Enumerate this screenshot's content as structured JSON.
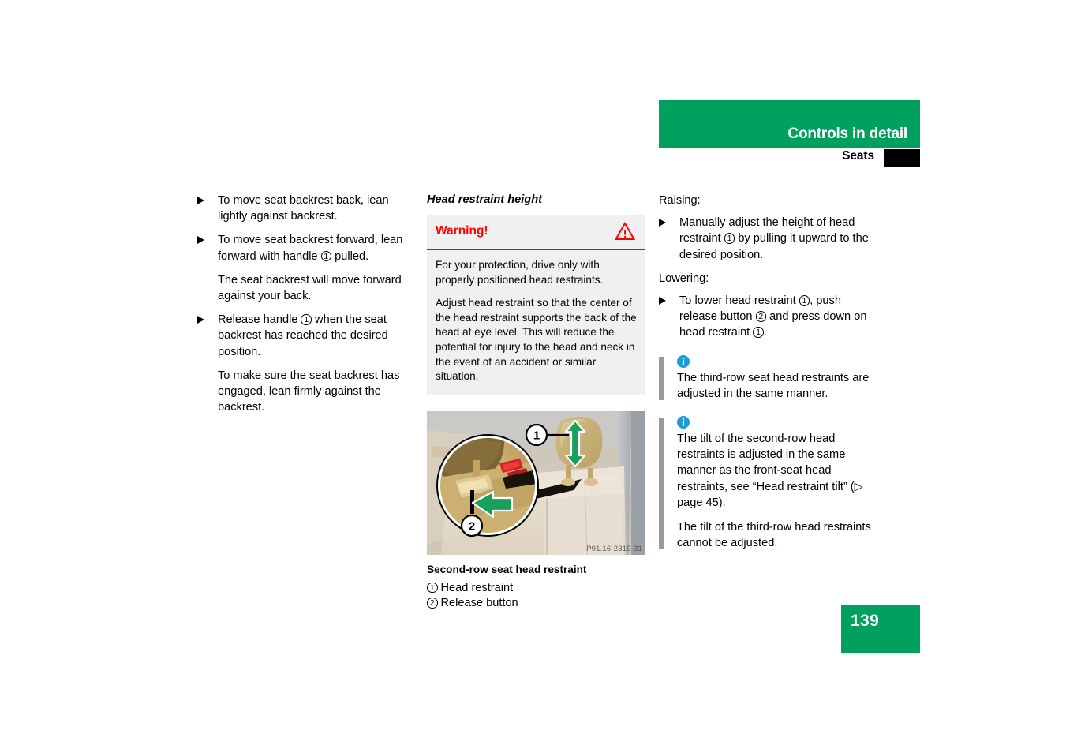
{
  "header": {
    "title": "Controls in detail",
    "section": "Seats",
    "tab_icon": "black-tab-marker"
  },
  "page_number": "139",
  "left_column": {
    "items": [
      {
        "type": "bullet",
        "icon": "triangle-bullet-icon",
        "parts": [
          {
            "t": "text",
            "v": "To move seat backrest back, lean lightly against backrest."
          }
        ]
      },
      {
        "type": "bullet",
        "icon": "triangle-bullet-icon",
        "parts": [
          {
            "t": "text",
            "v": "To move seat backrest forward, lean forward with handle "
          },
          {
            "t": "circled",
            "v": "1"
          },
          {
            "t": "text",
            "v": " pulled."
          }
        ]
      },
      {
        "type": "sub",
        "parts": [
          {
            "t": "text",
            "v": "The seat backrest will move forward against your back."
          }
        ]
      },
      {
        "type": "bullet",
        "icon": "triangle-bullet-icon",
        "parts": [
          {
            "t": "text",
            "v": "Release handle "
          },
          {
            "t": "circled",
            "v": "1"
          },
          {
            "t": "text",
            "v": " when the seat backrest has reached the desired position."
          }
        ]
      },
      {
        "type": "sub",
        "parts": [
          {
            "t": "text",
            "v": "To make sure the seat backrest has engaged, lean firmly against the backrest."
          }
        ]
      }
    ]
  },
  "middle_column": {
    "subheading": "Head restraint height",
    "warning": {
      "title": "Warning!",
      "icon": "warning-triangle-icon",
      "paragraphs": [
        "For your protection, drive only with properly positioned head restraints.",
        "Adjust head restraint so that the center of the head restraint supports the back of the head at eye level. This will reduce the potential for injury to the head and neck in the event of an accident or similar situation."
      ]
    },
    "figure": {
      "photo_id": "P91.16-2319-31",
      "alt_name": "second-row-seat-head-restraint-illustration",
      "caption": "Second-row seat head restraint",
      "legend": [
        {
          "num": "1",
          "label": "Head restraint"
        },
        {
          "num": "2",
          "label": "Release button"
        }
      ],
      "callouts": [
        {
          "num": "1",
          "meaning": "head restraint"
        },
        {
          "num": "2",
          "meaning": "release button"
        }
      ]
    }
  },
  "right_column": {
    "raising_label": "Raising:",
    "raising_bullet": [
      {
        "t": "text",
        "v": "Manually adjust the height of head restraint "
      },
      {
        "t": "circled",
        "v": "1"
      },
      {
        "t": "text",
        "v": " by pulling it upward to the desired position."
      }
    ],
    "lowering_label": "Lowering:",
    "lowering_bullet": [
      {
        "t": "text",
        "v": "To lower head restraint "
      },
      {
        "t": "circled",
        "v": "1"
      },
      {
        "t": "text",
        "v": ", push release button "
      },
      {
        "t": "circled",
        "v": "2"
      },
      {
        "t": "text",
        "v": " and press down on head restraint "
      },
      {
        "t": "circled",
        "v": "1"
      },
      {
        "t": "text",
        "v": "."
      }
    ],
    "notes": [
      {
        "icon": "info-icon",
        "paragraphs": [
          [
            {
              "t": "text",
              "v": "The third-row seat head restraints are adjusted in the same manner."
            }
          ]
        ]
      },
      {
        "icon": "info-icon",
        "paragraphs": [
          [
            {
              "t": "text",
              "v": "The tilt of the second-row head restraints is adjusted in the same manner as the front-seat head restraints, see “Head restraint tilt” ("
            },
            {
              "t": "ref",
              "v": "▷ page 45"
            },
            {
              "t": "text",
              "v": ")."
            }
          ],
          [
            {
              "t": "text",
              "v": "The tilt of the third-row head restraints cannot be adjusted."
            }
          ]
        ]
      }
    ]
  },
  "colors": {
    "brand_green": "#00a05f",
    "warning_red": "#ff0000",
    "info_blue": "#1e9ad6",
    "note_bar_gray": "#9b9b9b",
    "warning_bg": "#f0f0f0"
  }
}
